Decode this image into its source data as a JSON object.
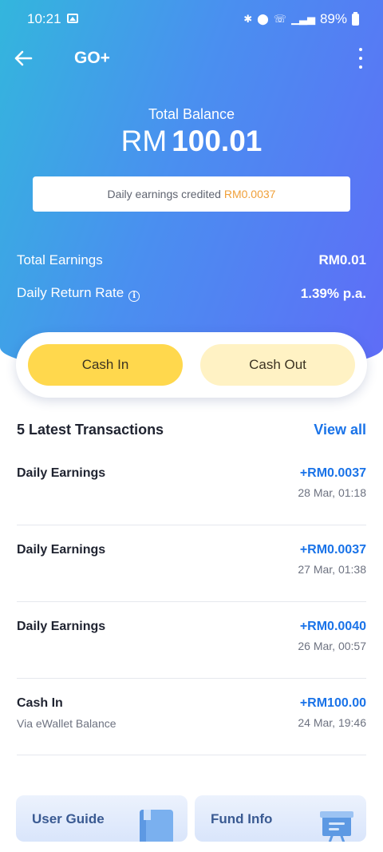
{
  "status_bar": {
    "time": "10:21",
    "battery": "89%"
  },
  "app_bar": {
    "title": "GO+"
  },
  "balance": {
    "label": "Total Balance",
    "currency": "RM",
    "amount": "100.01"
  },
  "daily_credit": {
    "text": "Daily earnings credited ",
    "amount": "RM0.0037"
  },
  "stats": [
    {
      "label": "Total Earnings",
      "value": "RM0.01"
    },
    {
      "label": "Daily Return Rate",
      "value": "1.39% p.a."
    }
  ],
  "actions": {
    "cash_in": "Cash In",
    "cash_out": "Cash Out"
  },
  "transactions": {
    "title": "5 Latest Transactions",
    "view_all": "View all",
    "items": [
      {
        "title": "Daily Earnings",
        "subtitle": "",
        "amount": "+RM0.0037",
        "date": "28 Mar, 01:18"
      },
      {
        "title": "Daily Earnings",
        "subtitle": "",
        "amount": "+RM0.0037",
        "date": "27 Mar, 01:38"
      },
      {
        "title": "Daily Earnings",
        "subtitle": "",
        "amount": "+RM0.0040",
        "date": "26 Mar, 00:57"
      },
      {
        "title": "Cash In",
        "subtitle": "Via eWallet Balance",
        "amount": "+RM100.00",
        "date": "24 Mar, 19:46"
      }
    ]
  },
  "bottom_cards": [
    {
      "label": "User Guide",
      "icon": "book-icon"
    },
    {
      "label": "Fund Info",
      "icon": "presentation-board-icon"
    }
  ],
  "colors": {
    "accent": "#1a73e8",
    "cash_in": "#ffd84d",
    "cash_out": "#fff2c4",
    "highlight": "#f0a03a"
  }
}
